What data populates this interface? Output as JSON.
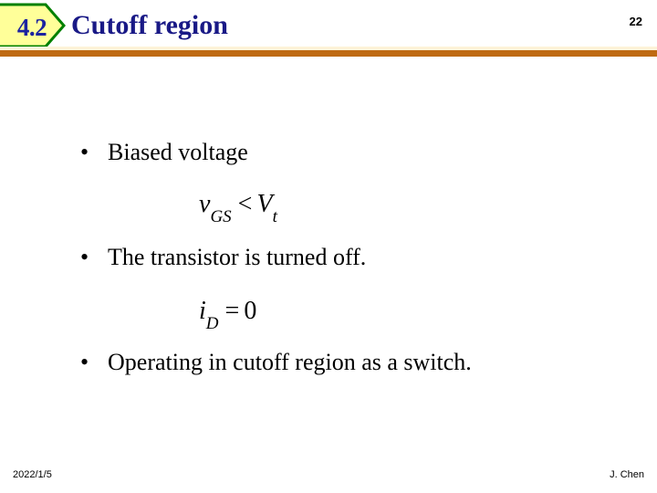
{
  "header": {
    "section_number": "4.2",
    "title": "Cutoff region",
    "page_number": "22",
    "badge_fill_color": "#ffff99",
    "badge_border_color": "#008000",
    "title_color": "#191986",
    "rule_color": "#bf6a12"
  },
  "body": {
    "bullet_marker": "•",
    "bullets": [
      {
        "text": "Biased voltage"
      },
      {
        "text": "The transistor is turned off."
      },
      {
        "text": "Operating in cutoff region as a switch."
      }
    ],
    "equations": [
      {
        "name": "gate-source-voltage-condition",
        "plain": "v_GS < V_t",
        "lhs_var": "v",
        "lhs_sub": "GS",
        "operator": "<",
        "rhs_var": "V",
        "rhs_sub": "t"
      },
      {
        "name": "drain-current-zero",
        "plain": "i_D = 0",
        "lhs_var": "i",
        "lhs_sub": "D",
        "operator": "=",
        "rhs_value": "0"
      }
    ]
  },
  "footer": {
    "date": "2022/1/5",
    "author": "J. Chen"
  }
}
